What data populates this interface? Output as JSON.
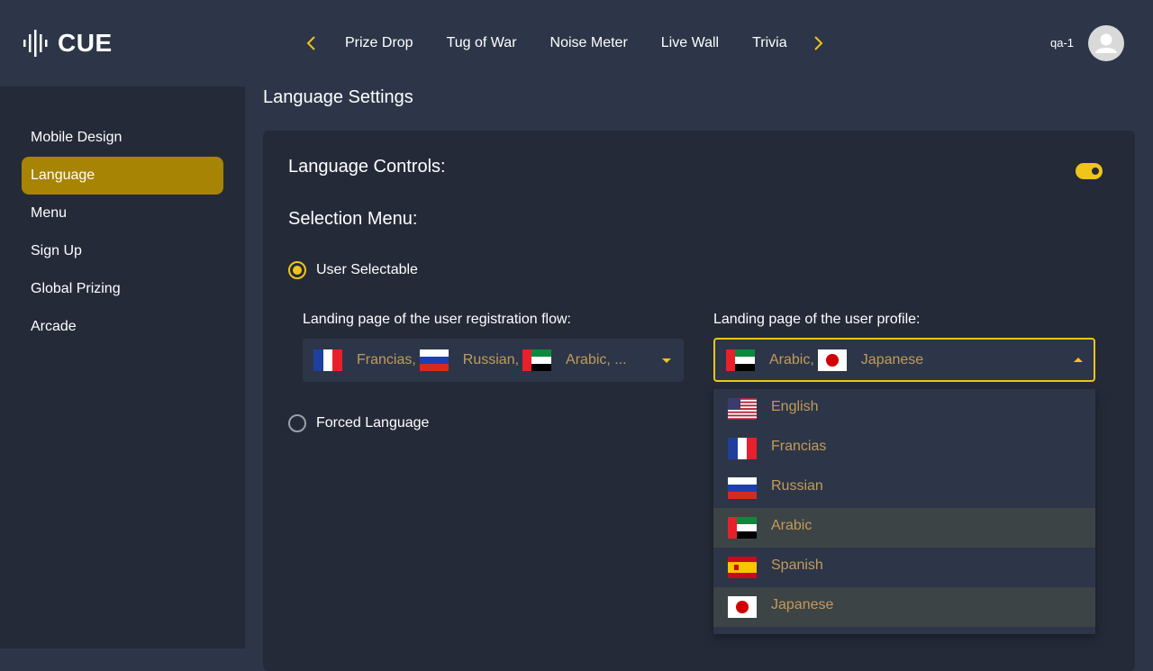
{
  "brand": {
    "logo_text": "CUE"
  },
  "topnav": {
    "tabs": [
      "Prize Drop",
      "Tug of War",
      "Noise Meter",
      "Live Wall",
      "Trivia"
    ],
    "user_name": "qa-1"
  },
  "sidebar": {
    "items": [
      "Mobile Design",
      "Language",
      "Menu",
      "Sign Up",
      "Global Prizing",
      "Arcade"
    ],
    "active": "Language"
  },
  "page": {
    "title": "Language Settings"
  },
  "controls": {
    "title": "Language Controls:",
    "toggle_on": true,
    "selection_title": "Selection Menu:",
    "user_selectable_label": "User Selectable",
    "forced_language_label": "Forced Language",
    "selected_mode": "User Selectable"
  },
  "registration": {
    "label": "Landing page of the user registration flow:",
    "values": [
      "Francias,",
      "Russian,",
      "Arabic, ..."
    ]
  },
  "profile": {
    "label": "Landing page of the user profile:",
    "values": [
      "Arabic,",
      "Japanese"
    ]
  },
  "dropdown": {
    "options": [
      "English",
      "Francias",
      "Russian",
      "Arabic",
      "Spanish",
      "Japanese"
    ],
    "selected": [
      "Arabic",
      "Japanese"
    ]
  },
  "colors": {
    "accent": "#f0c419",
    "active_bg": "#a78404",
    "option_text": "#c49a5a"
  }
}
